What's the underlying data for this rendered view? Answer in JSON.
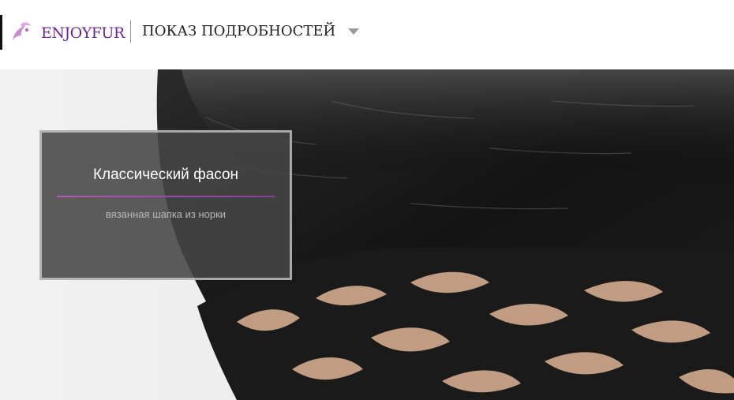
{
  "header": {
    "logo_text": "ENJOYFUR",
    "title": "ПОКАЗ ПОДРОБНОСТЕЙ",
    "dropdown_icon": "chevron-down-icon"
  },
  "banner": {
    "image": "knitted mink fur hat",
    "title": "Классический фасон",
    "subtitle": "вязанная шапка из норки",
    "accent_color": "#a04ab0"
  }
}
